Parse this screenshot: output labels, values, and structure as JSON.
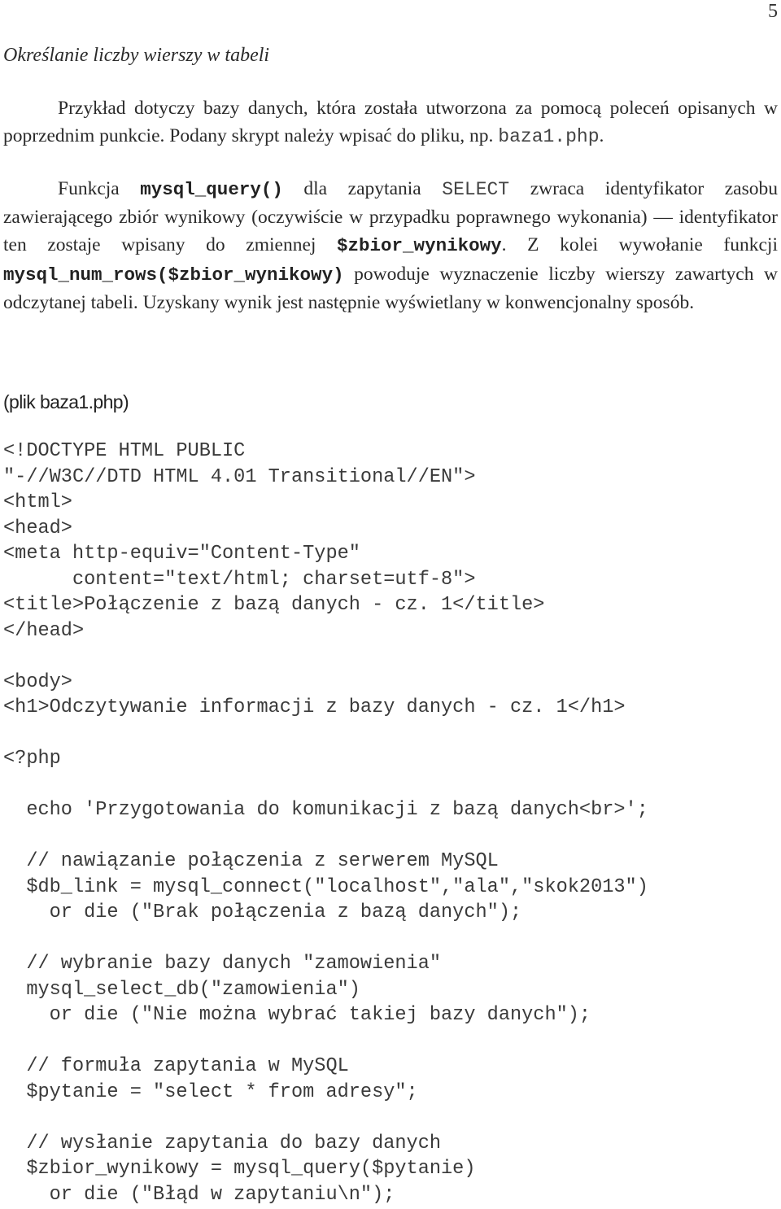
{
  "page": {
    "number": "5"
  },
  "section": {
    "title": "Określanie liczby wierszy w tabeli"
  },
  "paragraph1": {
    "text": "Przykład dotyczy bazy danych, która została utworzona za pomocą poleceń opisanych w poprzednim punkcie. Podany skrypt należy wpisać do pliku, np. ",
    "filename": "baza1.php",
    "trailing": "."
  },
  "paragraph2": {
    "t1": "Funkcja ",
    "code1": "mysql_query()",
    "t2": " dla zapytania ",
    "code2": "SELECT",
    "t3": " zwraca identyfikator zasobu zawierającego zbiór wynikowy (oczywiście w przypadku poprawnego wykonania) — identyfikator ten zostaje wpisany do zmiennej ",
    "code3": "$zbior_wynikowy",
    "t4": ". Z kolei wywołanie funkcji ",
    "code4": "mysql_num_rows($zbior_wynikowy)",
    "t5": " powoduje wyznaczenie liczby wierszy zawartych w odczytanej tabeli. Uzyskany wynik jest następnie wyświetlany w konwencjonalny sposób."
  },
  "file_label": "(plik baza1.php)",
  "code_lines": [
    "<!DOCTYPE HTML PUBLIC",
    "\"-//W3C//DTD HTML 4.01 Transitional//EN\">",
    "<html>",
    "<head>",
    "<meta http-equiv=\"Content-Type\"",
    "      content=\"text/html; charset=utf-8\">",
    "<title>Połączenie z bazą danych - cz. 1</title>",
    "</head>",
    "",
    "<body>",
    "<h1>Odczytywanie informacji z bazy danych - cz. 1</h1>",
    "",
    "<?php",
    "",
    "  echo 'Przygotowania do komunikacji z bazą danych<br>';",
    "",
    "  // nawiązanie połączenia z serwerem MySQL",
    "  $db_link = mysql_connect(\"localhost\",\"ala\",\"skok2013\")",
    "    or die (\"Brak połączenia z bazą danych\");",
    "",
    "  // wybranie bazy danych \"zamowienia\"",
    "  mysql_select_db(\"zamowienia\")",
    "    or die (\"Nie można wybrać takiej bazy danych\");",
    "",
    "  // formuła zapytania w MySQL",
    "  $pytanie = \"select * from adresy\";",
    "",
    "  // wysłanie zapytania do bazy danych",
    "  $zbior_wynikowy = mysql_query($pytanie)",
    "    or die (\"Błąd w zapytaniu\\n\");"
  ]
}
